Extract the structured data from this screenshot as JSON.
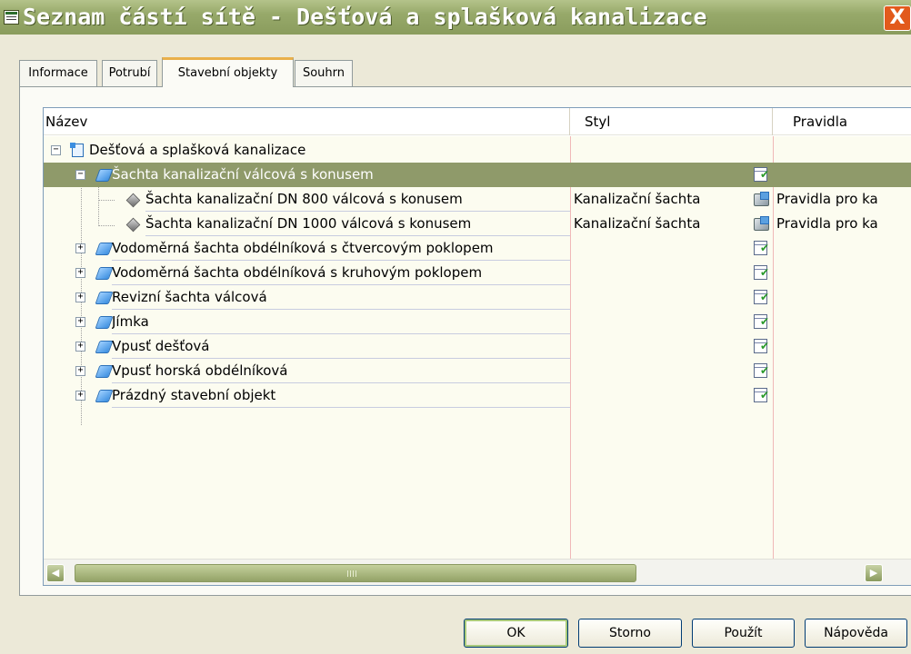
{
  "window": {
    "title": "Seznam částí sítě - Dešťová a splašková kanalizace",
    "close_label": "X"
  },
  "tabs": [
    {
      "label": "Informace",
      "active": false
    },
    {
      "label": "Potrubí",
      "active": false
    },
    {
      "label": "Stavební objekty",
      "active": true
    },
    {
      "label": "Souhrn",
      "active": false
    }
  ],
  "grid": {
    "columns": {
      "name": "Název",
      "style": "Styl",
      "rules": "Pravidla"
    },
    "rows": [
      {
        "name": "Dešťová a splašková kanalizace",
        "style": "",
        "rules": "",
        "level": 0,
        "icon": "root-network-icon",
        "expander": "−"
      },
      {
        "name": "Šachta kanalizační válcová s konusem",
        "style": "",
        "rules": "",
        "level": 1,
        "icon": "folder-icon",
        "expander": "−",
        "selected": true
      },
      {
        "name": "Šachta kanalizační DN 800 válcová s konusem",
        "style": "Kanalizační šachta",
        "rules": "Pravidla pro ka",
        "level": 2,
        "icon": "part-icon"
      },
      {
        "name": "Šachta kanalizační DN 1000 válcová s konusem",
        "style": "Kanalizační šachta",
        "rules": "Pravidla pro ka",
        "level": 2,
        "icon": "part-icon"
      },
      {
        "name": "Vodoměrná šachta obdélníková s čtvercovým poklopem",
        "style": "",
        "rules": "",
        "level": 1,
        "icon": "folder-icon",
        "expander": "+"
      },
      {
        "name": "Vodoměrná šachta obdélníková s kruhovým poklopem",
        "style": "",
        "rules": "",
        "level": 1,
        "icon": "folder-icon",
        "expander": "+"
      },
      {
        "name": "Revizní šachta válcová",
        "style": "",
        "rules": "",
        "level": 1,
        "icon": "folder-icon",
        "expander": "+"
      },
      {
        "name": "Jímka",
        "style": "",
        "rules": "",
        "level": 1,
        "icon": "folder-icon",
        "expander": "+"
      },
      {
        "name": "Vpusť dešťová",
        "style": "",
        "rules": "",
        "level": 1,
        "icon": "folder-icon",
        "expander": "+"
      },
      {
        "name": "Vpusť horská obdélníková",
        "style": "",
        "rules": "",
        "level": 1,
        "icon": "folder-icon",
        "expander": "+"
      },
      {
        "name": "Prázdný stavební objekt",
        "style": "",
        "rules": "",
        "level": 1,
        "icon": "folder-icon",
        "expander": "+"
      }
    ],
    "scroll_grip": "III"
  },
  "buttons": {
    "ok": "OK",
    "cancel": "Storno",
    "apply": "Použít",
    "help": "Nápověda"
  },
  "colors": {
    "titlebar": "#97a96a",
    "selection": "#8f9a6a",
    "close": "#e25a1c"
  }
}
